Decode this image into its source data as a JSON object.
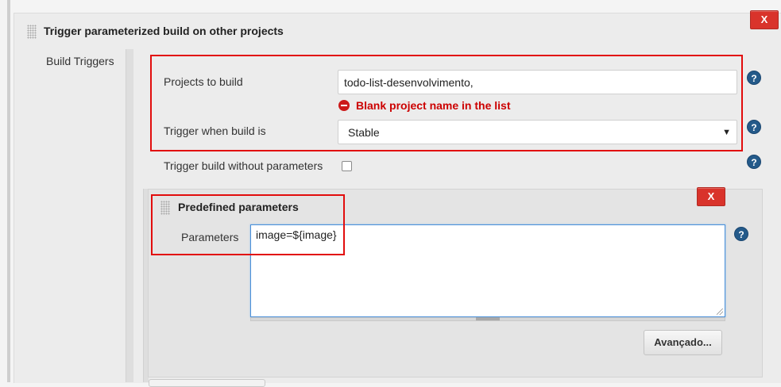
{
  "section": {
    "title": "Trigger parameterized build on other projects",
    "delete_label": "X",
    "side_label": "Build Triggers"
  },
  "form": {
    "projects_label": "Projects to build",
    "projects_value": "todo-list-desenvolvimento,",
    "error_message": "Blank project name in the list",
    "trigger_label": "Trigger when build is",
    "trigger_value": "Stable",
    "no_params_label": "Trigger build without parameters",
    "no_params_checked": false
  },
  "predefined": {
    "title": "Predefined parameters",
    "delete_label": "X",
    "params_label": "Parameters",
    "params_value": "image=${image}",
    "advanced_label": "Avançado..."
  },
  "help_glyph": "?",
  "select_arrow": "▼",
  "colors": {
    "delete_button": "#d9332b",
    "error_text": "#cc0000",
    "annotation_box": "#e20d0d",
    "help_icon": "#245a8a"
  }
}
